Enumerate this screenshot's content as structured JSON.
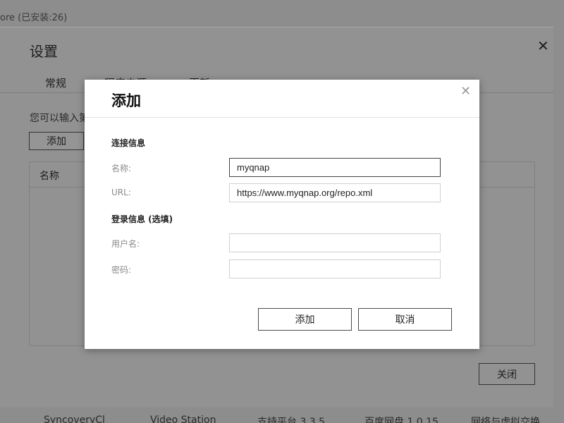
{
  "background": {
    "title": "ore (已安装:26)",
    "bottom_items": [
      "SyncoveryCl",
      "Video Station",
      "支持平台 3.3.5",
      "百度网盘 1.0.15",
      "网络与虚拟交换"
    ],
    "edge_marks": [
      "c",
      "c"
    ]
  },
  "settings": {
    "title": "设置",
    "tabs": [
      "常规",
      "程序来源",
      "更新"
    ],
    "hint": "您可以输入第",
    "add_label": "添加",
    "table_header": "名称",
    "close_label": "关闭"
  },
  "dialog": {
    "title": "添加",
    "connection_heading": "连接信息",
    "name_label": "名称:",
    "name_value": "myqnap",
    "url_label": "URL:",
    "url_value": "https://www.myqnap.org/repo.xml",
    "login_heading": "登录信息 (选填)",
    "username_label": "用户名:",
    "username_value": "",
    "password_label": "密码:",
    "password_value": "",
    "add_button": "添加",
    "cancel_button": "取消"
  },
  "colors": {
    "overlay": "#8d8d8d",
    "dialog_bg": "#ffffff",
    "accent_edge": "#2b4a7a"
  }
}
